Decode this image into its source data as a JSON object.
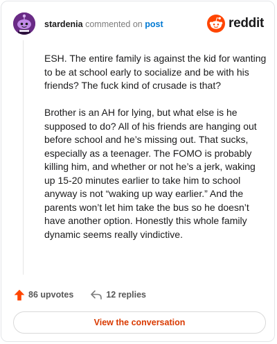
{
  "comment": {
    "username": "stardenia",
    "action_text": "commented on",
    "target_text": "post",
    "paragraphs": [
      "ESH. The entire family is against the kid for wanting to be at school early to socialize and be with his friends? The fuck kind of crusade is that?",
      "Brother is an AH for lying, but what else is he supposed to do? All of his friends are hanging out before school and he’s missing out. That sucks, especially as a teenager. The FOMO is probably killing him, and whether or not he’s a jerk, waking up 15-20 minutes earlier to take him to school anyway is not “waking up way earlier.” And the parents won’t let him take the bus so he doesn’t have another option. Honestly this whole family dynamic seems really vindictive."
    ]
  },
  "brand": {
    "wordmark": "reddit",
    "color": "#ff4500"
  },
  "stats": {
    "upvotes_label": "86 upvotes",
    "replies_label": "12 replies"
  },
  "cta": {
    "label": "View the conversation",
    "color": "#d93a00"
  },
  "icons": {
    "avatar": "snoo-avatar",
    "logo": "reddit-snoo-icon",
    "upvote": "upvote-arrow-icon",
    "reply": "reply-arrow-icon"
  }
}
